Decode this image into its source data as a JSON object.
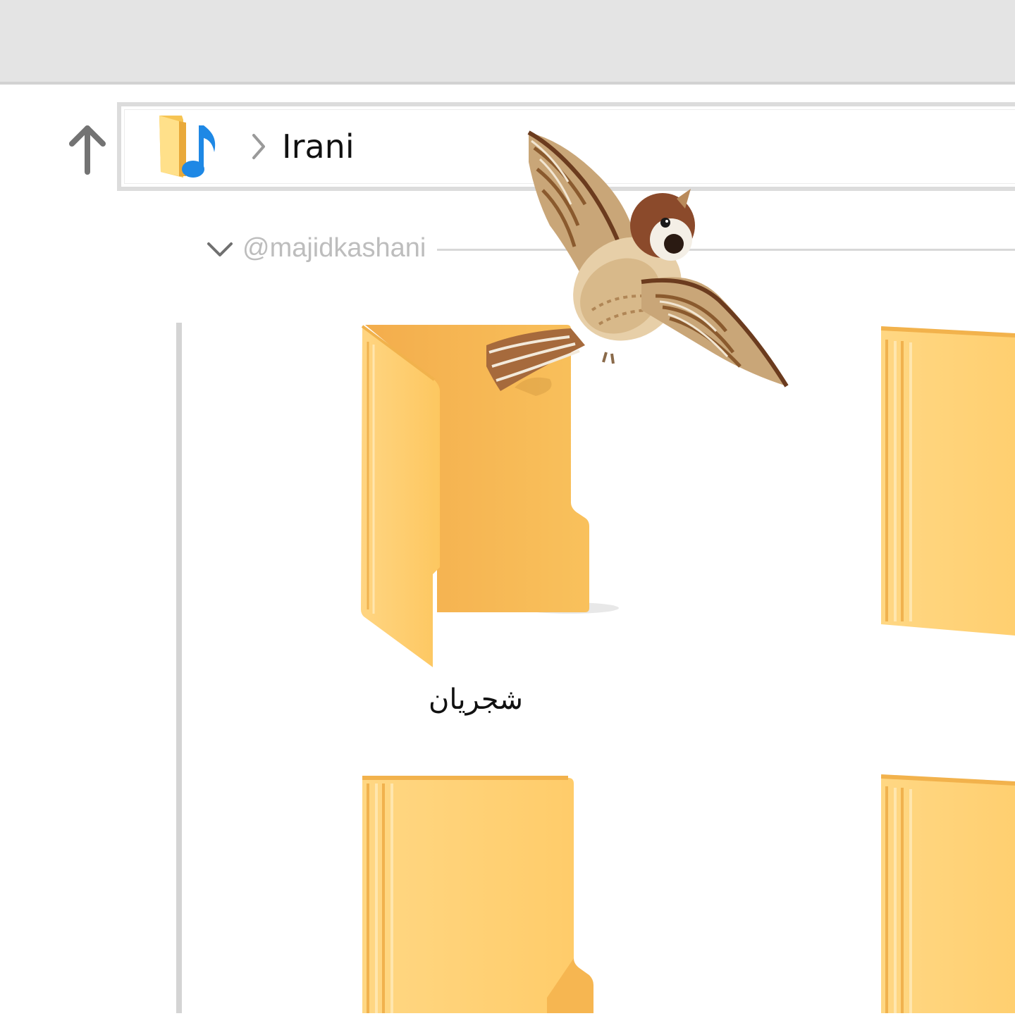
{
  "window": {
    "up_icon": "up-arrow-icon",
    "address_bar": {
      "folder_icon": "music-folder-icon",
      "separator_icon": "chevron-right-icon",
      "breadcrumb": [
        "Irani"
      ]
    }
  },
  "content": {
    "group": {
      "chevron_icon": "chevron-down-icon",
      "label": "@majidkashani"
    },
    "folders": [
      {
        "name": "شجریان",
        "state": "open"
      },
      {
        "name": "",
        "state": "closed"
      },
      {
        "name": "",
        "state": "closed"
      },
      {
        "name": "",
        "state": "closed"
      }
    ]
  },
  "decoration": {
    "image": "sparrow-in-flight"
  },
  "colors": {
    "titlebar": "#e4e4e4",
    "folder_light": "#ffd88a",
    "folder_dark": "#f2ae4a",
    "music_note": "#1e88e5",
    "watermark": "#bdbdbd"
  }
}
